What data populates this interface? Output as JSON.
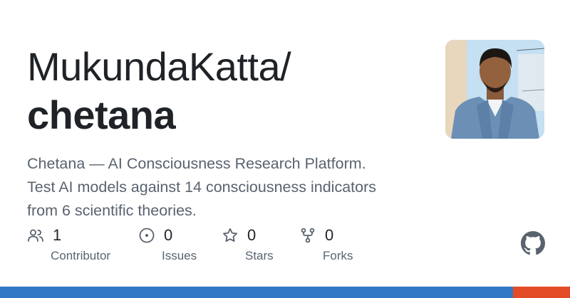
{
  "repo": {
    "owner": "MukundaKatta/",
    "name": "chetana",
    "description_lines": [
      "Chetana — AI Consciousness Research Platform.",
      "Test AI models against 14 consciousness indicators",
      "from 6 scientific theories."
    ]
  },
  "stats": [
    {
      "icon": "people-icon",
      "value": "1",
      "label": "Contributor"
    },
    {
      "icon": "issue-icon",
      "value": "0",
      "label": "Issues"
    },
    {
      "icon": "star-icon",
      "value": "0",
      "label": "Stars"
    },
    {
      "icon": "fork-icon",
      "value": "0",
      "label": "Forks"
    }
  ],
  "avatar": {
    "icon": "avatar-photo"
  },
  "logo": {
    "icon": "github-logo-icon"
  },
  "language_bar": {
    "segments": [
      {
        "color": "#3178c6",
        "fraction": 0.9
      },
      {
        "color": "#e34c26",
        "fraction": 0.1
      }
    ]
  },
  "colors": {
    "text_primary": "#1f2328",
    "text_secondary": "#59636e",
    "icon": "#59636e"
  }
}
